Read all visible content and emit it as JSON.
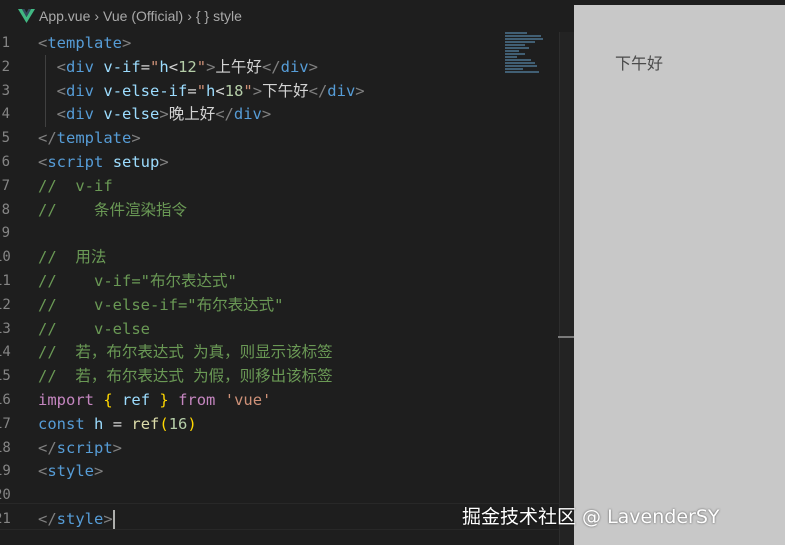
{
  "breadcrumb": {
    "file": "App.vue",
    "language": "Vue (Official)",
    "symbol_icon": "{ }",
    "symbol": "style"
  },
  "code": {
    "lines": [
      {
        "n": "1",
        "tokens": [
          {
            "t": "<",
            "c": "br"
          },
          {
            "t": "template",
            "c": "tag"
          },
          {
            "t": ">",
            "c": "br"
          }
        ]
      },
      {
        "n": "2",
        "tokens": [
          {
            "t": "  ",
            "c": "text"
          },
          {
            "t": "<",
            "c": "br"
          },
          {
            "t": "div",
            "c": "tag"
          },
          {
            "t": " ",
            "c": "text"
          },
          {
            "t": "v-if",
            "c": "attr"
          },
          {
            "t": "=",
            "c": "text"
          },
          {
            "t": "\"",
            "c": "str"
          },
          {
            "t": "h",
            "c": "attr"
          },
          {
            "t": "<",
            "c": "text"
          },
          {
            "t": "12",
            "c": "num"
          },
          {
            "t": "\"",
            "c": "str"
          },
          {
            "t": ">",
            "c": "br"
          },
          {
            "t": "上午好",
            "c": "text"
          },
          {
            "t": "</",
            "c": "br"
          },
          {
            "t": "div",
            "c": "tag"
          },
          {
            "t": ">",
            "c": "br"
          }
        ]
      },
      {
        "n": "3",
        "tokens": [
          {
            "t": "  ",
            "c": "text"
          },
          {
            "t": "<",
            "c": "br"
          },
          {
            "t": "div",
            "c": "tag"
          },
          {
            "t": " ",
            "c": "text"
          },
          {
            "t": "v-else-if",
            "c": "attr"
          },
          {
            "t": "=",
            "c": "text"
          },
          {
            "t": "\"",
            "c": "str"
          },
          {
            "t": "h",
            "c": "attr"
          },
          {
            "t": "<",
            "c": "text"
          },
          {
            "t": "18",
            "c": "num"
          },
          {
            "t": "\"",
            "c": "str"
          },
          {
            "t": ">",
            "c": "br"
          },
          {
            "t": "下午好",
            "c": "text"
          },
          {
            "t": "</",
            "c": "br"
          },
          {
            "t": "div",
            "c": "tag"
          },
          {
            "t": ">",
            "c": "br"
          }
        ]
      },
      {
        "n": "4",
        "tokens": [
          {
            "t": "  ",
            "c": "text"
          },
          {
            "t": "<",
            "c": "br"
          },
          {
            "t": "div",
            "c": "tag"
          },
          {
            "t": " ",
            "c": "text"
          },
          {
            "t": "v-else",
            "c": "attr"
          },
          {
            "t": ">",
            "c": "br"
          },
          {
            "t": "晚上好",
            "c": "text"
          },
          {
            "t": "</",
            "c": "br"
          },
          {
            "t": "div",
            "c": "tag"
          },
          {
            "t": ">",
            "c": "br"
          }
        ]
      },
      {
        "n": "5",
        "tokens": [
          {
            "t": "</",
            "c": "br"
          },
          {
            "t": "template",
            "c": "tag"
          },
          {
            "t": ">",
            "c": "br"
          }
        ]
      },
      {
        "n": "6",
        "tokens": [
          {
            "t": "<",
            "c": "br"
          },
          {
            "t": "script",
            "c": "tag"
          },
          {
            "t": " ",
            "c": "text"
          },
          {
            "t": "setup",
            "c": "attr"
          },
          {
            "t": ">",
            "c": "br"
          }
        ]
      },
      {
        "n": "7",
        "tokens": [
          {
            "t": "//  v-if",
            "c": "com"
          }
        ]
      },
      {
        "n": "8",
        "tokens": [
          {
            "t": "//    条件渲染指令",
            "c": "com"
          }
        ]
      },
      {
        "n": "9",
        "tokens": []
      },
      {
        "n": "10",
        "tokens": [
          {
            "t": "//  用法",
            "c": "com"
          }
        ]
      },
      {
        "n": "11",
        "tokens": [
          {
            "t": "//    v-if=\"布尔表达式\"",
            "c": "com"
          }
        ]
      },
      {
        "n": "12",
        "tokens": [
          {
            "t": "//    v-else-if=\"布尔表达式\"",
            "c": "com"
          }
        ]
      },
      {
        "n": "13",
        "tokens": [
          {
            "t": "//    v-else",
            "c": "com"
          }
        ]
      },
      {
        "n": "14",
        "tokens": [
          {
            "t": "//  若，布尔表达式 为真，则显示该标签",
            "c": "com"
          }
        ]
      },
      {
        "n": "15",
        "tokens": [
          {
            "t": "//  若，布尔表达式 为假，则移出该标签",
            "c": "com"
          }
        ]
      },
      {
        "n": "16",
        "tokens": [
          {
            "t": "import",
            "c": "kw"
          },
          {
            "t": " ",
            "c": "text"
          },
          {
            "t": "{",
            "c": "brace"
          },
          {
            "t": " ",
            "c": "text"
          },
          {
            "t": "ref",
            "c": "attr"
          },
          {
            "t": " ",
            "c": "text"
          },
          {
            "t": "}",
            "c": "brace"
          },
          {
            "t": " ",
            "c": "text"
          },
          {
            "t": "from",
            "c": "kw"
          },
          {
            "t": " ",
            "c": "text"
          },
          {
            "t": "'vue'",
            "c": "str"
          }
        ]
      },
      {
        "n": "17",
        "tokens": [
          {
            "t": "const",
            "c": "tag"
          },
          {
            "t": " ",
            "c": "text"
          },
          {
            "t": "h",
            "c": "attr"
          },
          {
            "t": " = ",
            "c": "text"
          },
          {
            "t": "ref",
            "c": "fn"
          },
          {
            "t": "(",
            "c": "brace"
          },
          {
            "t": "16",
            "c": "num"
          },
          {
            "t": ")",
            "c": "brace"
          }
        ]
      },
      {
        "n": "18",
        "tokens": [
          {
            "t": "</",
            "c": "br"
          },
          {
            "t": "script",
            "c": "tag"
          },
          {
            "t": ">",
            "c": "br"
          }
        ]
      },
      {
        "n": "19",
        "tokens": [
          {
            "t": "<",
            "c": "br"
          },
          {
            "t": "style",
            "c": "tag"
          },
          {
            "t": ">",
            "c": "br"
          }
        ]
      },
      {
        "n": "20",
        "tokens": []
      },
      {
        "n": "21",
        "tokens": [
          {
            "t": "</",
            "c": "br"
          },
          {
            "t": "style",
            "c": "tag"
          },
          {
            "t": ">",
            "c": "br"
          }
        ]
      }
    ]
  },
  "preview": {
    "rendered_text": "下午好"
  },
  "watermark": "掘金技术社区 @ LavenderSY",
  "colors": {
    "editor_bg": "#1e1e1e",
    "preview_bg": "#c8c8c8",
    "vue_green": "#41b883"
  }
}
